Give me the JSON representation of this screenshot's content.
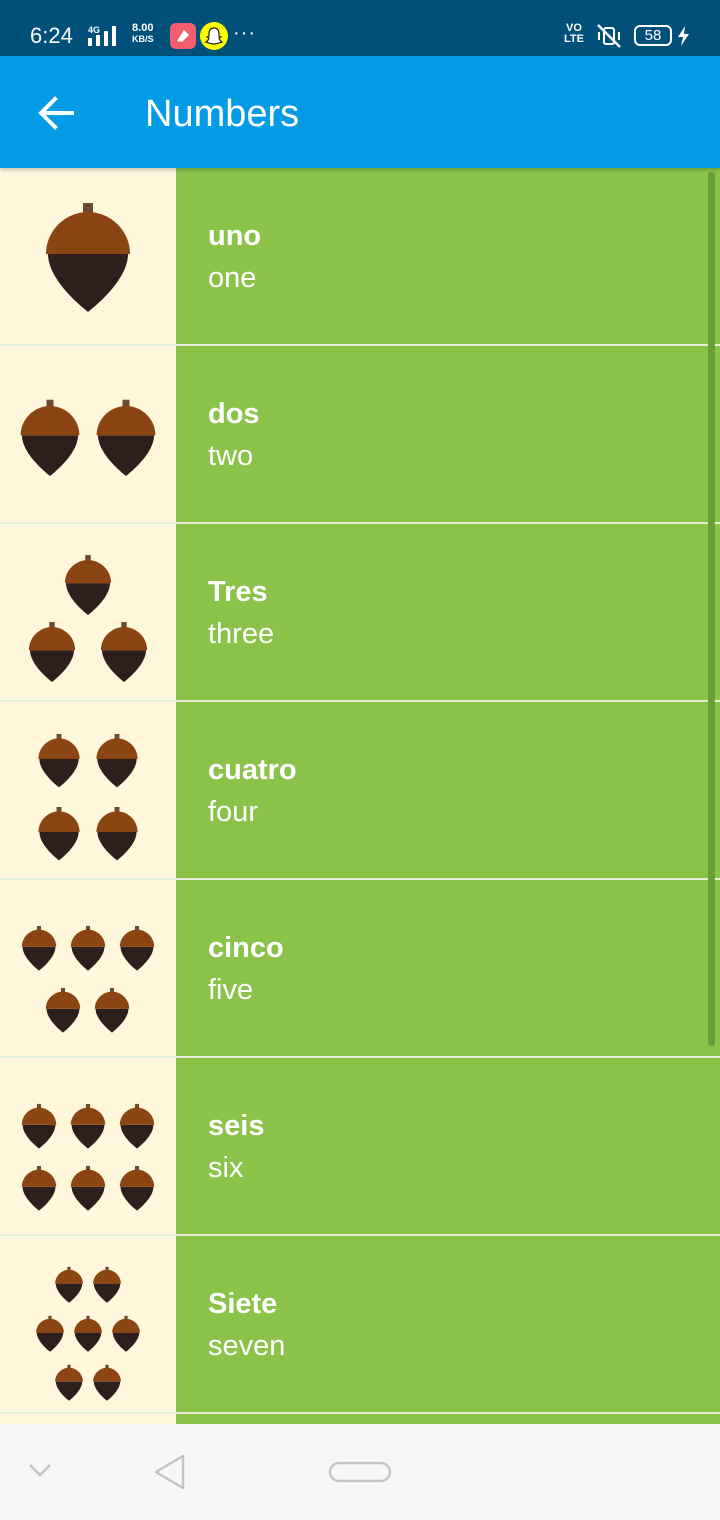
{
  "status_bar": {
    "time": "6:24",
    "network": "4G",
    "speed_value": "8.00",
    "speed_unit": "KB/S",
    "overflow": "···",
    "volte_top": "VO",
    "volte_bottom": "LTE",
    "battery": "58",
    "icons": [
      "signal-icon",
      "app-notification-icon",
      "snapchat-icon",
      "mute-icon",
      "battery-icon",
      "charging-icon"
    ]
  },
  "app_bar": {
    "title": "Numbers",
    "back_icon": "arrow-back-icon",
    "background": "#039be5"
  },
  "colors": {
    "list_background": "#8bc34a",
    "thumb_background": "#fff7dc",
    "acorn_cap": "#8b4513",
    "acorn_body": "#2e1f1d",
    "status_bar": "#01507a"
  },
  "list": {
    "items": [
      {
        "spanish": "uno",
        "english": "one",
        "count": 1
      },
      {
        "spanish": "dos",
        "english": "two",
        "count": 2
      },
      {
        "spanish": "Tres",
        "english": "three",
        "count": 3
      },
      {
        "spanish": "cuatro",
        "english": "four",
        "count": 4
      },
      {
        "spanish": "cinco",
        "english": "five",
        "count": 5
      },
      {
        "spanish": "seis",
        "english": "six",
        "count": 6
      },
      {
        "spanish": "Siete",
        "english": "seven",
        "count": 7
      }
    ]
  },
  "nav_bar": {
    "icons": [
      "collapse-chevron-icon",
      "back-triangle-icon",
      "home-pill-icon"
    ]
  }
}
